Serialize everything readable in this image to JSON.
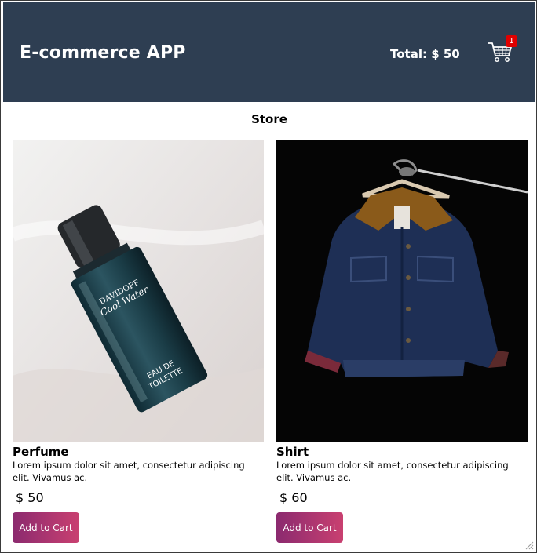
{
  "header": {
    "title": "E-commerce APP",
    "total": "Total: $ 50",
    "cart_count": "1"
  },
  "store": {
    "title": "Store"
  },
  "products": [
    {
      "name": "Perfume",
      "description": "Lorem ipsum dolor sit amet, consectetur adipiscing elit. Vivamus ac.",
      "price": "$ 50",
      "button": "Add to Cart"
    },
    {
      "name": "Shirt",
      "description": "Lorem ipsum dolor sit amet, consectetur adipiscing elit. Vivamus ac.",
      "price": "$ 60",
      "button": "Add to Cart"
    }
  ],
  "colors": {
    "header_bg": "#2e3e52",
    "badge": "#e00000",
    "button_start": "#8b2a6f",
    "button_end": "#c94070"
  },
  "icons": [
    "shopping-cart-icon",
    "resize-grip-icon"
  ]
}
